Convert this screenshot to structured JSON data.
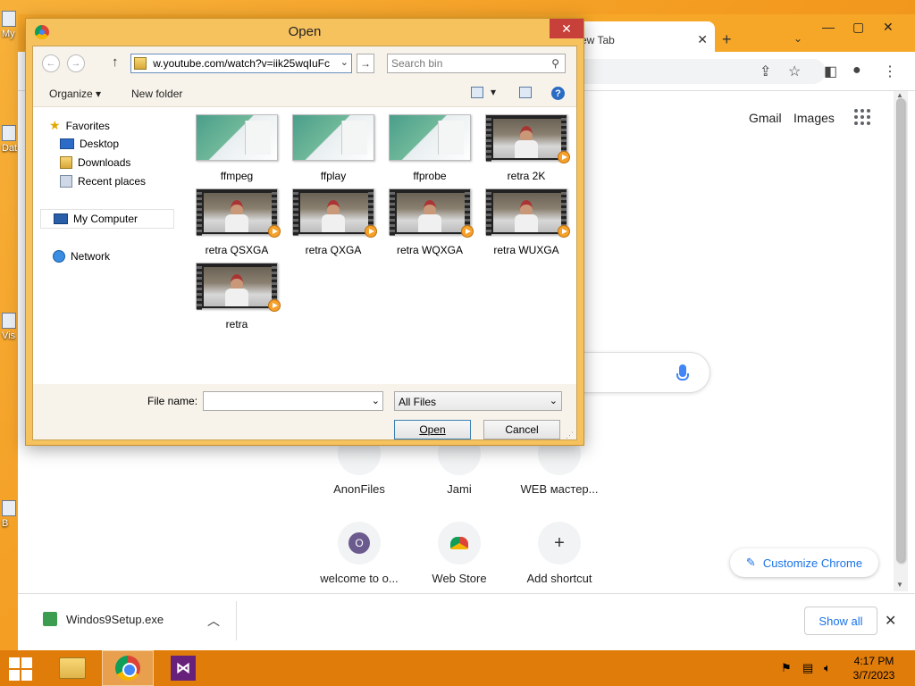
{
  "desktop": {
    "icons": [
      {
        "label": "My",
        "name": "desktop-icon-my-computer"
      },
      {
        "label": "Dat",
        "name": "desktop-icon-data"
      },
      {
        "label": "Vis",
        "name": "desktop-icon-visual-studio"
      },
      {
        "label": "B",
        "name": "desktop-icon-b"
      }
    ]
  },
  "chrome": {
    "tab_title": "ew Tab",
    "links": {
      "gmail": "Gmail",
      "images": "Images"
    },
    "shortcuts": [
      {
        "label": "AnonFiles",
        "glyph": ""
      },
      {
        "label": "Jami",
        "glyph": ""
      },
      {
        "label": "WEB мастер...",
        "glyph": ""
      },
      {
        "label": "welcome to o...",
        "glyph": "O"
      },
      {
        "label": "Web Store",
        "glyph": ""
      },
      {
        "label": "Add shortcut",
        "glyph": "+"
      }
    ],
    "customize_label": "Customize Chrome",
    "download": {
      "filename": "Windos9Setup.exe",
      "show_all": "Show all"
    }
  },
  "dialog": {
    "title": "Open",
    "address": "w.youtube.com/watch?v=iik25wqIuFc",
    "search_placeholder": "Search bin",
    "organize": "Organize ▾",
    "new_folder": "New folder",
    "nav": {
      "favorites": "Favorites",
      "desktop": "Desktop",
      "downloads": "Downloads",
      "recent": "Recent places",
      "computer": "My Computer",
      "network": "Network"
    },
    "files": [
      {
        "name": "ffmpeg",
        "kind": "app"
      },
      {
        "name": "ffplay",
        "kind": "app"
      },
      {
        "name": "ffprobe",
        "kind": "app"
      },
      {
        "name": "retra 2K",
        "kind": "video"
      },
      {
        "name": "retra QSXGA",
        "kind": "video"
      },
      {
        "name": "retra QXGA",
        "kind": "video"
      },
      {
        "name": "retra WQXGA",
        "kind": "video"
      },
      {
        "name": "retra WUXGA",
        "kind": "video"
      },
      {
        "name": "retra",
        "kind": "video"
      }
    ],
    "file_name_label": "File name:",
    "file_name_value": "",
    "file_type": "All Files",
    "open_label": "Open",
    "cancel_label": "Cancel"
  },
  "taskbar": {
    "time": "4:17 PM",
    "date": "3/7/2023"
  }
}
